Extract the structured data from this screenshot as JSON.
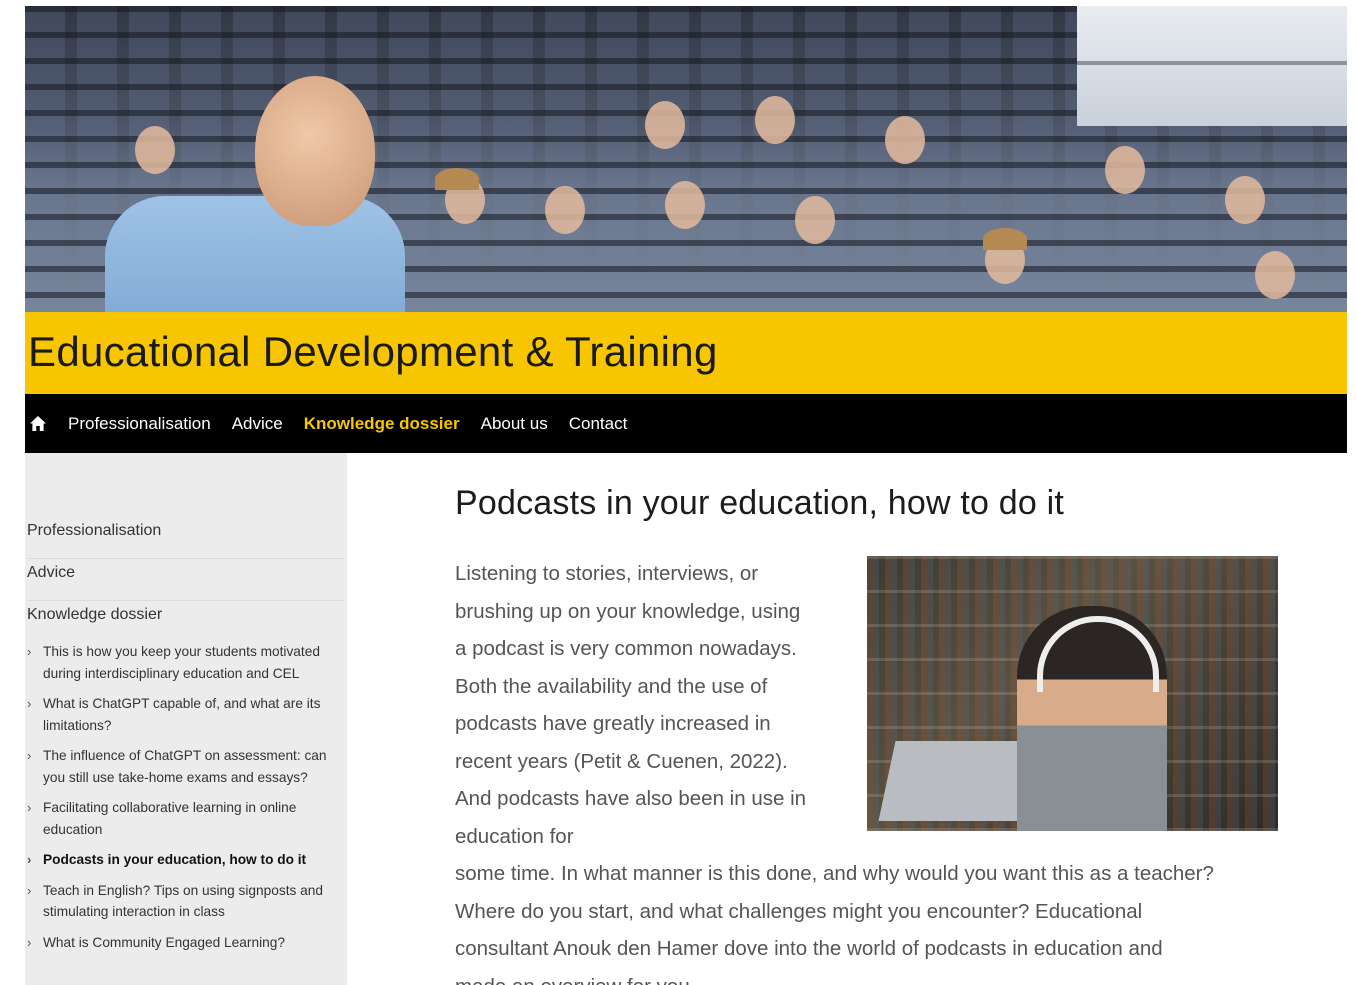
{
  "site": {
    "title": "Educational Development & Training"
  },
  "nav": {
    "home_icon": "home-icon",
    "items": [
      {
        "label": "Professionalisation",
        "active": false
      },
      {
        "label": "Advice",
        "active": false
      },
      {
        "label": "Knowledge dossier",
        "active": true
      },
      {
        "label": "About us",
        "active": false
      },
      {
        "label": "Contact",
        "active": false
      }
    ]
  },
  "sidebar": {
    "top_items": [
      "Professionalisation",
      "Advice",
      "Knowledge dossier"
    ],
    "sub_items": [
      "This is how you keep your students motivated during interdisciplinary education and CEL",
      "What is ChatGPT capable of, and what are its limitations?",
      "The influence of ChatGPT on assessment: can you still use take-home exams and essays?",
      "Facilitating collaborative learning in online education",
      "Podcasts in your education, how to do it",
      "Teach in English? Tips on using signposts and stimulating interaction in class",
      "What is Community Engaged Learning?"
    ],
    "current_index": 4
  },
  "article": {
    "title": "Podcasts in your education, how to do it",
    "para_col": "Listening to stories, interviews, or brushing up on your knowledge, using a podcast is very common nowadays. Both the availability and the use of podcasts have greatly increased in recent years (Petit & Cuenen, 2022). And podcasts have also been in use in education for",
    "para_full": "some time. In what manner is this done, and why would you want this as a teacher? Where do you start, and what challenges might you encounter? Educational consultant Anouk den Hamer dove into the world of podcasts in education and made an overview for you."
  },
  "colors": {
    "banner": "#f7c600",
    "nav_bg": "#000000",
    "nav_active": "#f7c600",
    "sidebar_bg": "#ececec"
  }
}
